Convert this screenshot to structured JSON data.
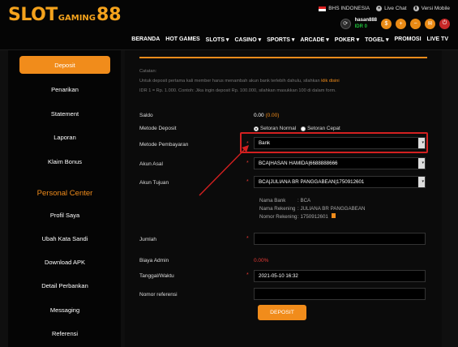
{
  "brand": {
    "slot": "SLOT",
    "gaming": "GAMING",
    "num": "88"
  },
  "topbar": {
    "language": "BHS INDONESIA",
    "live_chat": "Live Chat",
    "mobile": "Versi Mobile"
  },
  "user": {
    "name": "hasan888",
    "balance": "IDR 0"
  },
  "nav": [
    "BERANDA",
    "HOT GAMES",
    "SLOTS ▾",
    "CASINO ▾",
    "SPORTS ▾",
    "ARCADE ▾",
    "POKER ▾",
    "TOGEL ▾",
    "PROMOSI",
    "LIVE TV"
  ],
  "sidebar": {
    "items": [
      "Deposit",
      "Penarikan",
      "Statement",
      "Laporan",
      "Klaim Bonus"
    ],
    "section_title": "Personal Center",
    "personal": [
      "Profil Saya",
      "Ubah Kata Sandi",
      "Download APK",
      "Detail Perbankan",
      "Messaging",
      "Referensi"
    ]
  },
  "form": {
    "note_title": "Catatan:",
    "note_line1": "Untuk deposit pertama kali member harus menambah akun bank terlebih dahulu, silahkan",
    "note_link": "klik disini",
    "note_line2": "IDR 1 = Rp. 1.000. Contoh: Jika ingin deposit Rp. 100.000, silahkan masukkan 100 di dalam form.",
    "saldo_label": "Saldo",
    "saldo_value": "0.00",
    "saldo_extra": "(0.00)",
    "metode_deposit_label": "Metode Deposit",
    "option_normal": "Setoran Normal",
    "option_cepat": "Setoran Cepat",
    "metode_pembayaran_label": "Metode Pembayaran",
    "metode_pembayaran_value": "Bank",
    "akun_asal_label": "Akun Asal",
    "akun_asal_value": "BCA|HASAN HAMIDA|6688888666",
    "akun_tujuan_label": "Akun Tujuan",
    "akun_tujuan_value": "BCA|JULIANA BR PANGGABEAN|1750912601",
    "bank_info": {
      "nama_bank_label": "Nama Bank",
      "nama_bank_value": ": BCA",
      "nama_rekening_label": "Nama Rekening",
      "nama_rekening_value": ": JULIANA BR PANGGABEAN",
      "nomor_rekening_label": "Nomor Rekening",
      "nomor_rekening_value": ": 1750912601"
    },
    "jumlah_label": "Jumlah",
    "biaya_admin_label": "Biaya Admin",
    "biaya_admin_value": "0.00%",
    "tanggal_label": "Tanggal/Waktu",
    "tanggal_value": "2021-05-10 16:32",
    "nomor_referensi_label": "Nomor referensi",
    "submit_label": "DEPOSIT"
  },
  "colors": {
    "accent": "#f18c1b",
    "highlight": "#d32020",
    "balance": "#1fbf3a"
  }
}
